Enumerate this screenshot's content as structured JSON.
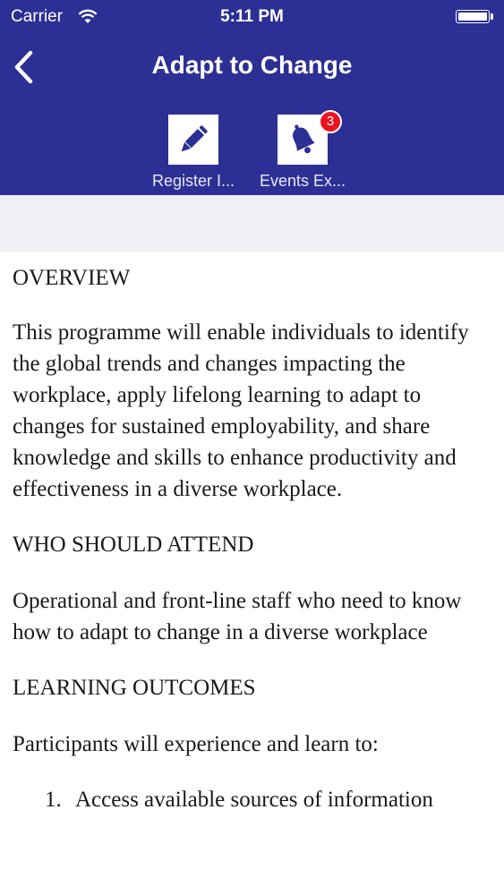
{
  "status_bar": {
    "carrier": "Carrier",
    "time": "5:11 PM"
  },
  "nav": {
    "title": "Adapt to Change"
  },
  "toolbar": {
    "items": [
      {
        "label": "Register I...",
        "icon": "pencil-icon"
      },
      {
        "label": "Events Ex...",
        "icon": "bell-icon",
        "badge": "3"
      }
    ]
  },
  "content": {
    "overview_heading": "OVERVIEW",
    "overview_text": "This programme will enable individuals to identify the global trends and changes impacting the workplace, apply lifelong learning to adapt to changes for sustained employability, and share knowledge and skills to enhance productivity and effectiveness in a diverse workplace.",
    "who_heading": "WHO SHOULD ATTEND",
    "who_text": "Operational and front-line staff who need to know how to adapt to change in a diverse workplace",
    "outcomes_heading": "LEARNING OUTCOMES",
    "outcomes_intro": "Participants will experience and learn to:",
    "outcomes_list": [
      {
        "number": "1.",
        "text": "Access available sources of information"
      }
    ]
  },
  "colors": {
    "header_bg": "#2c2f93",
    "badge_bg": "#e8141d",
    "band_bg": "#efeff4"
  }
}
